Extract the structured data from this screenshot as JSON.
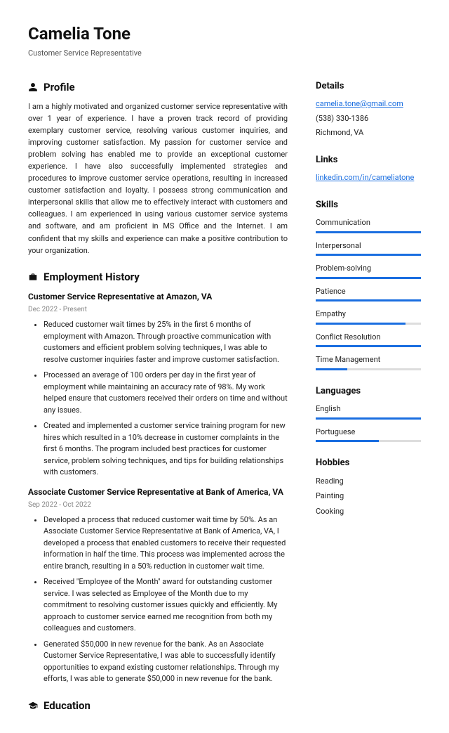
{
  "header": {
    "name": "Camelia Tone",
    "subtitle": "Customer Service Representative"
  },
  "profile": {
    "heading": "Profile",
    "text": "I am a highly motivated and organized customer service representative with over 1 year of experience. I have a proven track record of providing exemplary customer service, resolving various customer inquiries, and improving customer satisfaction. My passion for customer service and problem solving has enabled me to provide an exceptional customer experience. I have also successfully implemented strategies and procedures to improve customer service operations, resulting in increased customer satisfaction and loyalty. I possess strong communication and interpersonal skills that allow me to effectively interact with customers and colleagues. I am experienced in using various customer service systems and software, and am proficient in MS Office and the Internet. I am confident that my skills and experience can make a positive contribution to your organization."
  },
  "employment": {
    "heading": "Employment History",
    "jobs": [
      {
        "title": "Customer Service Representative at Amazon, VA",
        "date": "Dec 2022 - Present",
        "bullets": [
          "Reduced customer wait times by 25% in the first 6 months of employment with Amazon. Through proactive communication with customers and efficient problem solving techniques, I was able to resolve customer inquiries faster and improve customer satisfaction.",
          "Processed an average of 100 orders per day in the first year of employment while maintaining an accuracy rate of 98%. My work helped ensure that customers received their orders on time and without any issues.",
          "Created and implemented a customer service training program for new hires which resulted in a 10% decrease in customer complaints in the first 6 months. The program included best practices for customer service, problem solving techniques, and tips for building relationships with customers."
        ]
      },
      {
        "title": "Associate Customer Service Representative at Bank of America, VA",
        "date": "Sep 2022 - Oct 2022",
        "bullets": [
          "Developed a process that reduced customer wait time by 50%. As an Associate Customer Service Representative at Bank of America, VA, I developed a process that enabled customers to receive their requested information in half the time. This process was implemented across the entire branch, resulting in a 50% reduction in customer wait time.",
          "Received \"Employee of the Month\" award for outstanding customer service. I was selected as Employee of the Month due to my commitment to resolving customer issues quickly and efficiently. My approach to customer service earned me recognition from both my colleagues and customers.",
          "Generated $50,000 in new revenue for the bank. As an Associate Customer Service Representative, I was able to successfully identify opportunities to expand existing customer relationships. Through my efforts, I was able to generate $50,000 in new revenue for the bank."
        ]
      }
    ]
  },
  "education": {
    "heading": "Education"
  },
  "details": {
    "heading": "Details",
    "email": "camelia.tone@gmail.com",
    "phone": "(538) 330-1386",
    "location": "Richmond, VA"
  },
  "links": {
    "heading": "Links",
    "items": [
      "linkedin.com/in/cameliatone"
    ]
  },
  "skills": {
    "heading": "Skills",
    "items": [
      {
        "label": "Communication",
        "level": 100
      },
      {
        "label": "Interpersonal",
        "level": 100
      },
      {
        "label": "Problem-solving",
        "level": 100
      },
      {
        "label": "Patience",
        "level": 100
      },
      {
        "label": "Empathy",
        "level": 85
      },
      {
        "label": "Conflict Resolution",
        "level": 100
      },
      {
        "label": "Time Management",
        "level": 30
      }
    ]
  },
  "languages": {
    "heading": "Languages",
    "items": [
      {
        "label": "English",
        "level": 100
      },
      {
        "label": "Portuguese",
        "level": 60
      }
    ]
  },
  "hobbies": {
    "heading": "Hobbies",
    "items": [
      "Reading",
      "Painting",
      "Cooking"
    ]
  }
}
